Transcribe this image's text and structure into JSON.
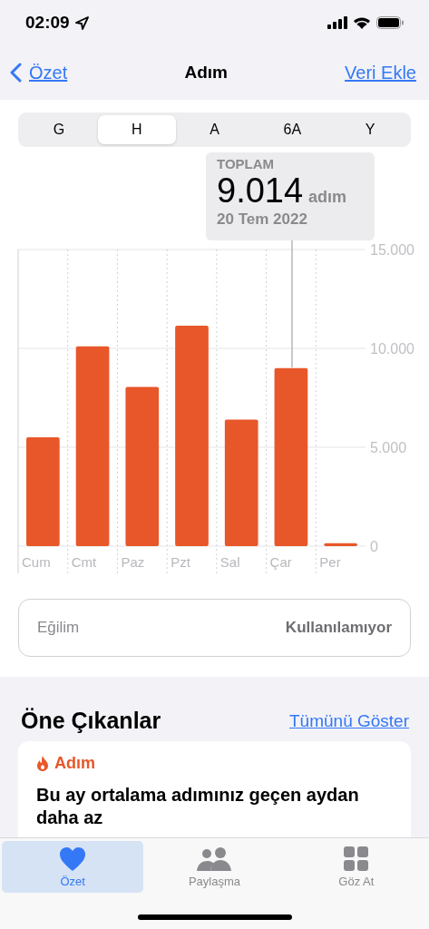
{
  "status_bar": {
    "time": "02:09"
  },
  "nav": {
    "back": "Özet",
    "title": "Adım",
    "action": "Veri Ekle"
  },
  "segments": [
    {
      "label": "G",
      "selected": false
    },
    {
      "label": "H",
      "selected": true
    },
    {
      "label": "A",
      "selected": false
    },
    {
      "label": "6A",
      "selected": false
    },
    {
      "label": "Y",
      "selected": false
    }
  ],
  "tooltip": {
    "label": "TOPLAM",
    "value": "9.014",
    "unit": "adım",
    "date": "20 Tem 2022"
  },
  "chart_data": {
    "type": "bar",
    "categories": [
      "Cum",
      "Cmt",
      "Paz",
      "Pzt",
      "Sal",
      "Çar",
      "Per"
    ],
    "series": [
      {
        "color": "#e8572a",
        "values": [
          5500,
          10100,
          8050,
          11150,
          6400,
          9000,
          150
        ]
      }
    ],
    "ylim": [
      0,
      15000
    ],
    "yticks": [
      {
        "value": 0,
        "label": "0"
      },
      {
        "value": 5000,
        "label": "5.000"
      },
      {
        "value": 10000,
        "label": "10.000"
      },
      {
        "value": 15000,
        "label": "15.000"
      }
    ]
  },
  "trend": {
    "label": "Eğilim",
    "value": "Kullanılamıyor"
  },
  "highlights": {
    "title": "Öne Çıkanlar",
    "link": "Tümünü Göster",
    "cards": [
      {
        "category": "Adım",
        "text": "Bu ay ortalama adımınız geçen aydan daha az"
      }
    ]
  },
  "tab_bar": [
    {
      "label": "Özet",
      "kind": "heart",
      "selected": true
    },
    {
      "label": "Paylaşma",
      "kind": "people",
      "selected": false
    },
    {
      "label": "Göz At",
      "kind": "grid",
      "selected": false
    }
  ]
}
